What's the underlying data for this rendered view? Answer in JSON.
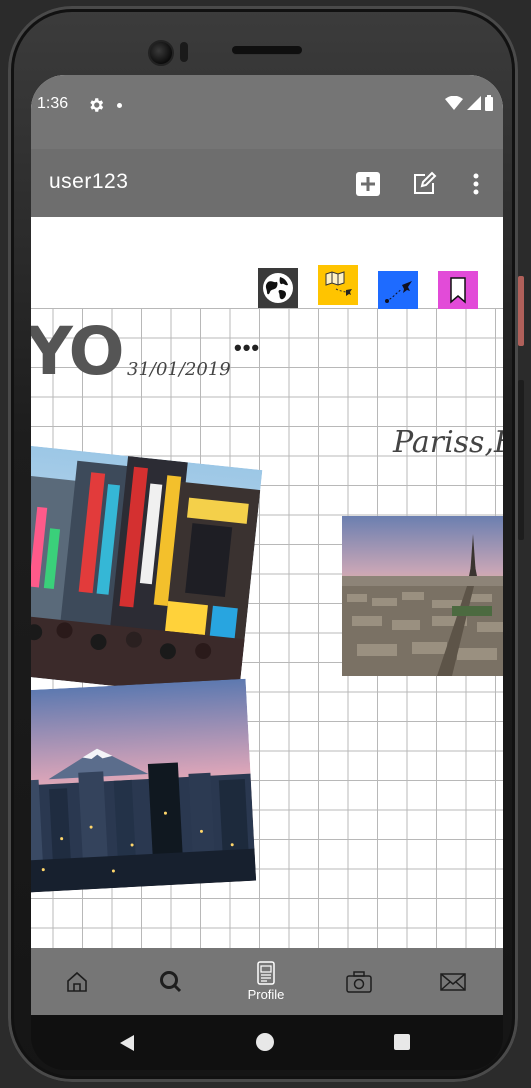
{
  "status_bar": {
    "time": "1:36",
    "icons": [
      "settings-icon",
      "notification-dot",
      "wifi-icon",
      "signal-icon",
      "battery-icon"
    ]
  },
  "app_bar": {
    "username": "user123",
    "actions": [
      "add-icon",
      "edit-icon",
      "more-vert-icon"
    ]
  },
  "canvas": {
    "stickers": [
      {
        "name": "globe-sticker",
        "bg": "#3a3a3a"
      },
      {
        "name": "map-plane-sticker",
        "bg": "#ffc400"
      },
      {
        "name": "plane-route-sticker",
        "bg": "#1e6bff"
      },
      {
        "name": "bookmark-sticker",
        "bg": "#e24bd8"
      }
    ],
    "title_fragment": "YO",
    "date": "31/01/2019",
    "caption": "Pariss,Fra",
    "more": "•••"
  },
  "bottom_nav": {
    "items": [
      {
        "name": "home",
        "label": ""
      },
      {
        "name": "search",
        "label": ""
      },
      {
        "name": "profile",
        "label": "Profile"
      },
      {
        "name": "camera",
        "label": ""
      },
      {
        "name": "messages",
        "label": ""
      }
    ]
  },
  "colors": {
    "status_bar": "#757575",
    "app_bar": "#6e6e6e",
    "bottom_nav": "#767676",
    "grid_line": "#b8b8b8"
  }
}
